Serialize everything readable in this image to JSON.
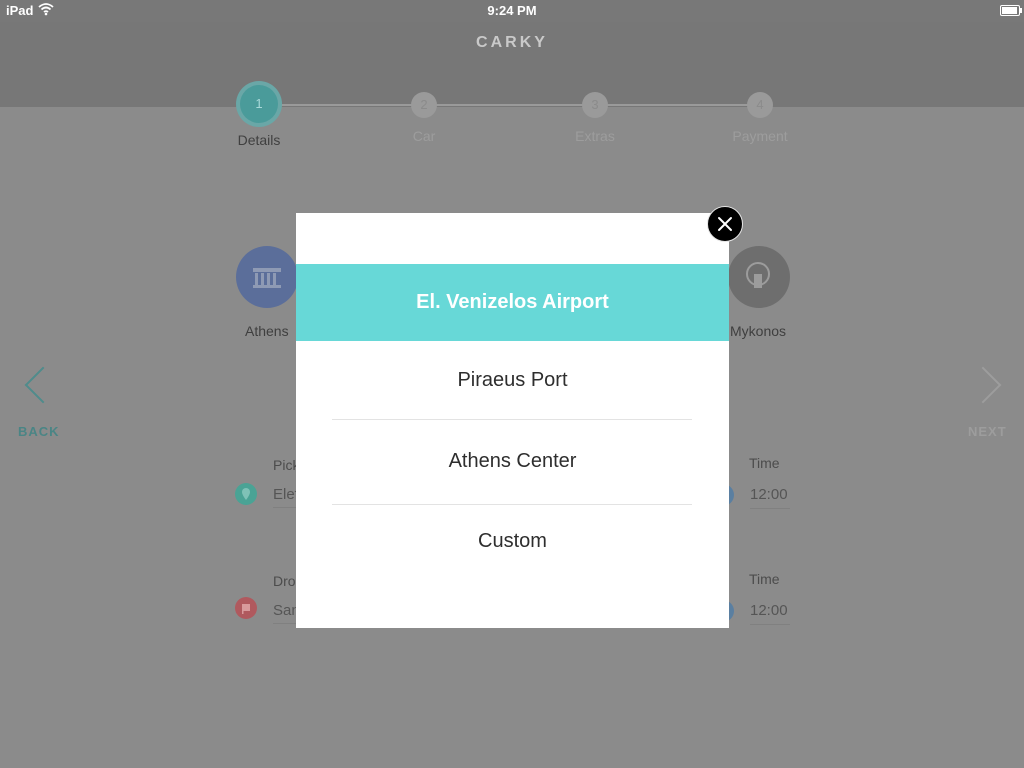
{
  "status_bar": {
    "device": "iPad",
    "time": "9:24 PM"
  },
  "header": {
    "logo": "CARKY"
  },
  "steps": [
    {
      "number": "1",
      "label": "Details"
    },
    {
      "number": "2",
      "label": "Car"
    },
    {
      "number": "3",
      "label": "Extras"
    },
    {
      "number": "4",
      "label": "Payment"
    }
  ],
  "locations": {
    "left_label": "Athens",
    "right_label": "Mykonos"
  },
  "nav": {
    "back": "BACK",
    "next": "NEXT"
  },
  "pickup": {
    "label": "Pick",
    "value": "Elef",
    "time_label": "Time",
    "time_value": "12:00"
  },
  "dropoff": {
    "label": "Dro",
    "value": "San",
    "time_label": "Time",
    "time_value": "12:00"
  },
  "modal": {
    "options": [
      "El. Venizelos Airport",
      "Piraeus Port",
      "Athens Center",
      "Custom"
    ],
    "selected_index": 0
  },
  "colors": {
    "accent": "#67d8d7",
    "overlay": "#8b8b8b"
  }
}
